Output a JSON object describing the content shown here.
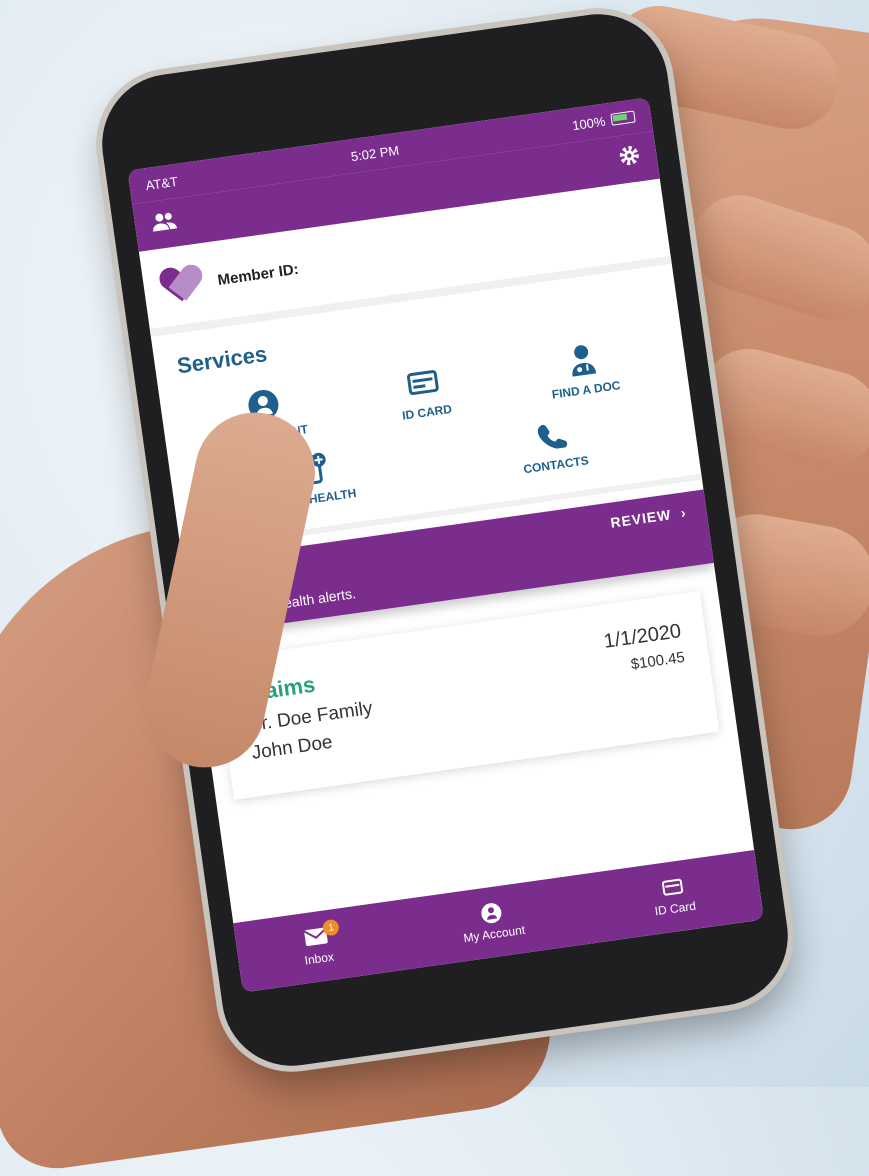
{
  "status_bar": {
    "carrier": "AT&T",
    "time": "5:02 PM",
    "battery": "100%"
  },
  "header": {
    "left_icon": "people-icon",
    "right_icon": "gear-icon"
  },
  "member": {
    "label": "Member ID:",
    "logo_icon": "heart-logo-icon"
  },
  "services": {
    "title": "Services",
    "items": [
      {
        "label": "MY ACCOUNT",
        "icon": "account-circle-icon"
      },
      {
        "label": "ID CARD",
        "icon": "id-card-icon"
      },
      {
        "label": "FIND A DOC",
        "icon": "doctor-icon"
      },
      {
        "label": "TELEHEALTH",
        "icon": "telehealth-phone-icon"
      },
      {
        "label": "CONTACTS",
        "icon": "phone-icon"
      }
    ]
  },
  "alert": {
    "text": "Important health alerts.",
    "action": "REVIEW",
    "action_icon": "chevron-right-icon"
  },
  "claims": {
    "title": "Claims",
    "provider": "Dr. Doe Family",
    "patient": "John Doe",
    "date": "1/1/2020",
    "amount": "$100.45"
  },
  "tab_bar": {
    "items": [
      {
        "label": "Inbox",
        "icon": "mail-icon",
        "badge": "1"
      },
      {
        "label": "My Account",
        "icon": "account-circle-icon"
      },
      {
        "label": "ID Card",
        "icon": "id-card-icon"
      }
    ]
  },
  "colors": {
    "brand_purple": "#7b2d8e",
    "services_blue": "#1f5f8b",
    "claims_green": "#2aa07a",
    "badge_orange": "#f28c28"
  }
}
